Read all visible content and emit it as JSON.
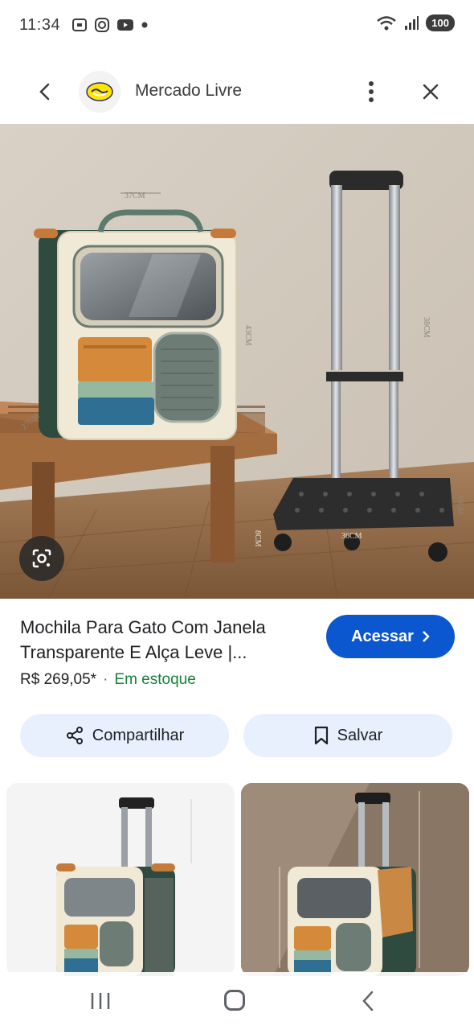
{
  "status_bar": {
    "time": "11:34",
    "battery": "100",
    "icons": [
      "screenshot-icon",
      "instagram-icon",
      "youtube-icon",
      "notification-dot-icon",
      "wifi-icon",
      "signal-icon"
    ]
  },
  "header": {
    "site_name": "Mercado Livre",
    "icons": [
      "back-arrow-icon",
      "mercado-livre-logo",
      "more-vert-icon",
      "close-icon"
    ]
  },
  "main_image": {
    "subject": "cat carrier backpack with window on trolley",
    "dimension_labels": [
      "37CM",
      "43CM",
      "27CM",
      "38CM",
      "30CM",
      "36CM",
      "8CM"
    ]
  },
  "product": {
    "title": "Mochila Para Gato Com Janela Transparente E Alça Leve |...",
    "price": "R$ 269,05*",
    "separator": "·",
    "stock": "Em estoque"
  },
  "buttons": {
    "visit": "Acessar",
    "share": "Compartilhar",
    "save": "Salvar"
  },
  "related": [
    {
      "label": "thumbnail-1"
    },
    {
      "label": "thumbnail-2"
    }
  ],
  "colors": {
    "accent_blue": "#0b57d0",
    "chip_bg": "#e8f0fe",
    "stock_green": "#188038"
  }
}
